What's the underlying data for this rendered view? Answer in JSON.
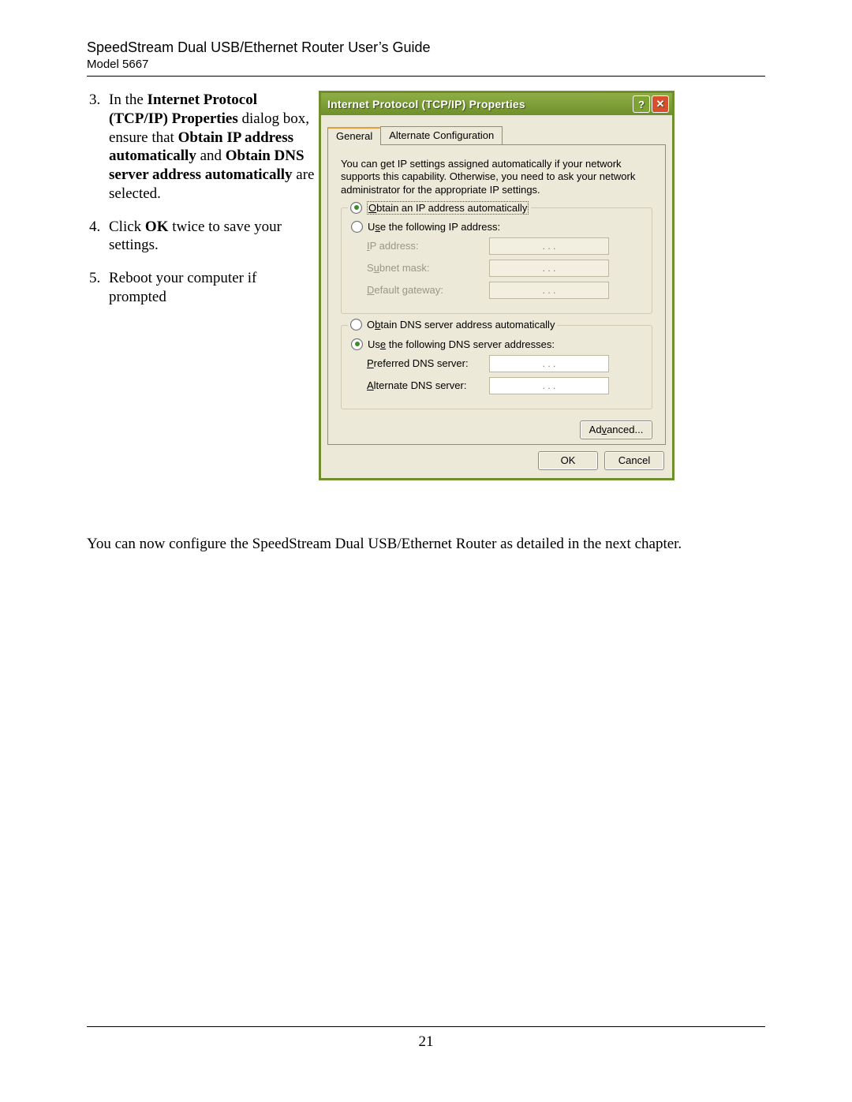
{
  "header": {
    "title": "SpeedStream Dual USB/Ethernet Router User’s Guide",
    "model": "Model 5667"
  },
  "steps": {
    "s3_a": "In the ",
    "s3_b": "Internet Protocol (TCP/IP) Properties",
    "s3_c": " dialog box, ensure that ",
    "s3_d": "Obtain IP address automatically",
    "s3_e": " and ",
    "s3_f": "Obtain DNS server address automatically",
    "s3_g": " are selected.",
    "s4_a": "Click ",
    "s4_b": "OK",
    "s4_c": " twice to save your settings.",
    "s5": "Reboot your computer if prompted"
  },
  "dialog": {
    "title": "Internet Protocol (TCP/IP) Properties",
    "help": "?",
    "close": "✕",
    "tab_general": "General",
    "tab_alt": "Alternate Configuration",
    "info": "You can get IP settings assigned automatically if your network supports this capability. Otherwise, you need to ask your network administrator for the appropriate IP settings.",
    "r_obtain_ip": "Obtain an IP address automatically",
    "r_use_ip": "Use the following IP address:",
    "lbl_ip": "IP address:",
    "lbl_subnet": "Subnet mask:",
    "lbl_gateway": "Default gateway:",
    "r_obtain_dns": "Obtain DNS server address automatically",
    "r_use_dns": "Use the following DNS server addresses:",
    "lbl_pref_dns": "Preferred DNS server:",
    "lbl_alt_dns": "Alternate DNS server:",
    "btn_advanced": "Advanced...",
    "btn_ok": "OK",
    "btn_cancel": "Cancel",
    "ip_dots": ".       .       ."
  },
  "after": "You can now configure the SpeedStream Dual USB/Ethernet Router as detailed in the next chapter.",
  "page_number": "21"
}
